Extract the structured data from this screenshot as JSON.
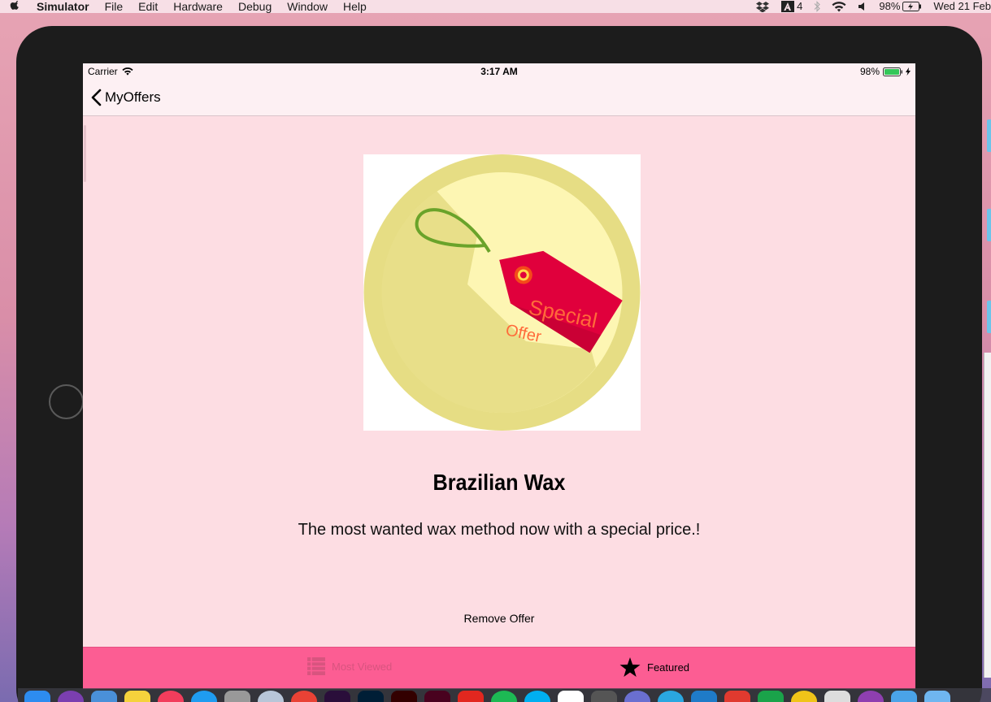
{
  "menubar": {
    "app_name": "Simulator",
    "items": [
      "File",
      "Edit",
      "Hardware",
      "Debug",
      "Window",
      "Help"
    ],
    "status": {
      "adobe_count": "4",
      "battery": "98%",
      "datetime": "Wed 21 Feb"
    }
  },
  "simulator": {
    "statusbar": {
      "carrier": "Carrier",
      "time": "3:17 AM",
      "battery": "98%"
    },
    "navbar": {
      "back_label": "MyOffers"
    },
    "offer": {
      "image_text_1": "Special",
      "image_text_2": "Offer",
      "title": "Brazilian Wax",
      "description": "The most wanted wax method now with a special price.!",
      "remove_label": "Remove Offer"
    },
    "tabbar": {
      "tabs": [
        {
          "label": "Most Viewed",
          "icon": "list-icon",
          "selected": false
        },
        {
          "label": "Featured",
          "icon": "star-icon",
          "selected": true
        }
      ]
    }
  },
  "colors": {
    "screen_background": "#fddde3",
    "navbar_background": "#fdf0f3",
    "tabbar_background": "#fc5d93",
    "tab_inactive": "#d8547f",
    "tag_red": "#e0003c",
    "badge_yellow": "#fdf6b3"
  }
}
